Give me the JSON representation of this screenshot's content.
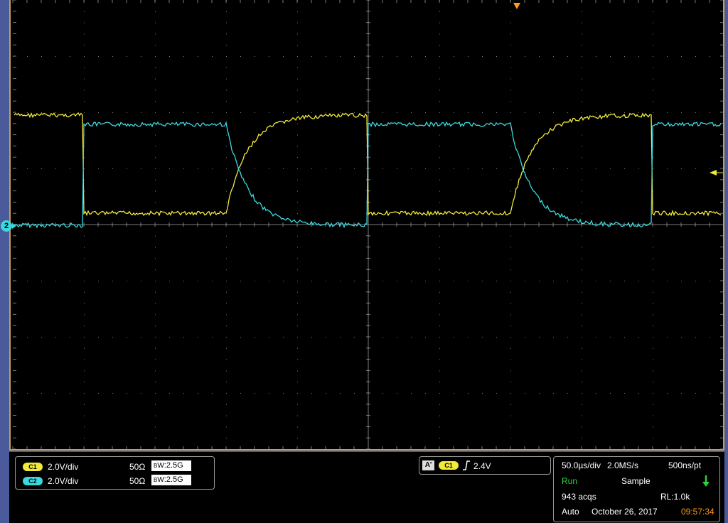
{
  "channels": [
    {
      "badge": "C1",
      "scale": "2.0V/div",
      "impedance": "50Ω",
      "bw_label": "W",
      "bw_value": ":2.5G",
      "color": "#f2ea3a"
    },
    {
      "badge": "C2",
      "scale": "2.0V/div",
      "impedance": "50Ω",
      "bw_label": "W",
      "bw_value": ":2.5G",
      "color": "#3ad9e0"
    }
  ],
  "trigger": {
    "type": "A'",
    "source": "C1",
    "edge_icon": "rising-edge-icon",
    "level": "2.4V"
  },
  "acquisition": {
    "timebase": "50.0µs/div",
    "sample_rate": "2.0MS/s",
    "resolution": "500ns/pt",
    "state": "Run",
    "mode": "Sample",
    "acqs": "943 acqs",
    "record_length": "RL:1.0k",
    "trigger_mode": "Auto",
    "date": "October 26, 2017",
    "time": "09:57:34"
  },
  "ch2_marker_label": "2",
  "colors": {
    "ch1": "#f2ea3a",
    "ch2": "#3ad9e0",
    "grid": "#7a7a7a",
    "frame": "#c8a050",
    "trigger_marker": "#ff9a1a",
    "run": "#30d040"
  }
}
